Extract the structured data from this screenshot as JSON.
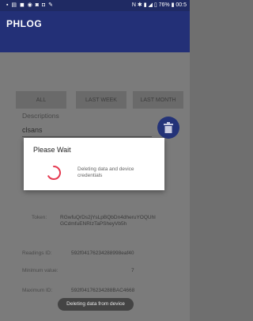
{
  "status_bar": {
    "left_icons": "▪ ▤ ◼ ◉ ◙ ◘ ✎",
    "right_text": "N ✱ ▮ ◢ ▯ 76% ▮ 00:5"
  },
  "app": {
    "title": "PHLOG"
  },
  "filters": [
    {
      "label": "ALL"
    },
    {
      "label": "LAST WEEK"
    },
    {
      "label": "LAST MONTH"
    }
  ],
  "description": {
    "label": "Descriptions",
    "value": "clsans"
  },
  "details": [
    {
      "key": "Token:",
      "value": "RGwfuQrDs2jYsLpBQbDn4dheruYOQUhlGCdmfuENRIzTaPSheyVb5h"
    },
    {
      "key": "Readings ID:",
      "value": "592f04176234288998eaf40"
    },
    {
      "key": "Minimum value:",
      "value": "7"
    },
    {
      "key": "Maximum ID:",
      "value": "592f04176234288BAC4668"
    }
  ],
  "dialog": {
    "title": "Please Wait",
    "message": "Deleting data and device credentials",
    "spinner_color": "#e53950"
  },
  "toast": {
    "text": "Deleting data from device"
  },
  "colors": {
    "app_bar": "#233077",
    "status_bar": "#1f2a63",
    "accent": "#243378"
  }
}
